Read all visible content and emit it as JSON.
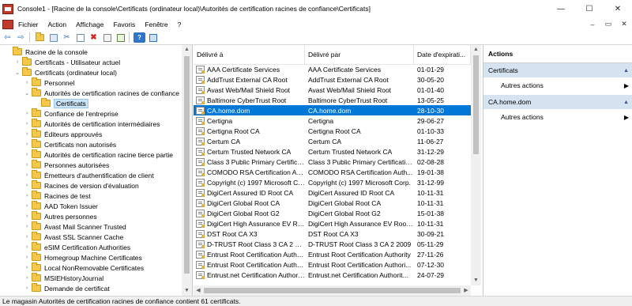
{
  "window": {
    "title": "Console1 - [Racine de la console\\Certificats (ordinateur local)\\Autorités de certification racines de confiance\\Certificats]",
    "minimize": "—",
    "maximize": "☐",
    "close": "✕"
  },
  "menu": {
    "items": [
      "Fichier",
      "Action",
      "Affichage",
      "Favoris",
      "Fenêtre",
      "?"
    ],
    "mdi_minimize": "–",
    "mdi_restore": "▭",
    "mdi_close": "✕"
  },
  "toolbar": {
    "buttons": [
      "back-icon",
      "forward-icon",
      "up-folder-icon",
      "properties-icon",
      "cut-icon",
      "copy-icon",
      "delete-icon",
      "properties-sheet-icon",
      "export-icon",
      "help-icon",
      "show-hide-icon"
    ],
    "back": "⇦",
    "forward": "⇨",
    "cut": "✂",
    "delete": "✖",
    "help": "?"
  },
  "tree": {
    "items": [
      {
        "label": "Racine de la console",
        "level": 0,
        "chevron": "",
        "selected": false
      },
      {
        "label": "Certificats - Utilisateur actuel",
        "level": 1,
        "chevron": "›",
        "selected": false
      },
      {
        "label": "Certificats (ordinateur local)",
        "level": 1,
        "chevron": "⌄",
        "selected": false
      },
      {
        "label": "Personnel",
        "level": 2,
        "chevron": "›",
        "selected": false
      },
      {
        "label": "Autorités de certification racines de confiance",
        "level": 2,
        "chevron": "⌄",
        "selected": false
      },
      {
        "label": "Certificats",
        "level": 3,
        "chevron": "",
        "selected": true
      },
      {
        "label": "Confiance de l'entreprise",
        "level": 2,
        "chevron": "›",
        "selected": false
      },
      {
        "label": "Autorités de certification intermédiaires",
        "level": 2,
        "chevron": "›",
        "selected": false
      },
      {
        "label": "Éditeurs approuvés",
        "level": 2,
        "chevron": "›",
        "selected": false
      },
      {
        "label": "Certificats non autorisés",
        "level": 2,
        "chevron": "›",
        "selected": false
      },
      {
        "label": "Autorités de certification racine tierce partie",
        "level": 2,
        "chevron": "›",
        "selected": false
      },
      {
        "label": "Personnes autorisées",
        "level": 2,
        "chevron": "›",
        "selected": false
      },
      {
        "label": "Émetteurs d'authentification de client",
        "level": 2,
        "chevron": "›",
        "selected": false
      },
      {
        "label": "Racines de version d'évaluation",
        "level": 2,
        "chevron": "›",
        "selected": false
      },
      {
        "label": "Racines de test",
        "level": 2,
        "chevron": "›",
        "selected": false
      },
      {
        "label": "AAD Token Issuer",
        "level": 2,
        "chevron": "›",
        "selected": false
      },
      {
        "label": "Autres personnes",
        "level": 2,
        "chevron": "›",
        "selected": false
      },
      {
        "label": "Avast Mail Scanner Trusted",
        "level": 2,
        "chevron": "›",
        "selected": false
      },
      {
        "label": "Avast SSL Scanner Cache",
        "level": 2,
        "chevron": "›",
        "selected": false
      },
      {
        "label": "eSIM Certification Authorities",
        "level": 2,
        "chevron": "›",
        "selected": false
      },
      {
        "label": "Homegroup Machine Certificates",
        "level": 2,
        "chevron": "›",
        "selected": false
      },
      {
        "label": "Local NonRemovable Certificates",
        "level": 2,
        "chevron": "›",
        "selected": false
      },
      {
        "label": "MSIEHistoryJournal",
        "level": 2,
        "chevron": "›",
        "selected": false
      },
      {
        "label": "Demande de certificat",
        "level": 2,
        "chevron": "›",
        "selected": false
      }
    ],
    "scroll_up": "▲",
    "scroll_down": "▼"
  },
  "list": {
    "headers": [
      "Délivré à",
      "Délivré par",
      "Date d'expirati..."
    ],
    "rows": [
      {
        "issued_to": "AAA Certificate Services",
        "issued_by": "AAA Certificate Services",
        "expires": "01-01-29",
        "selected": false
      },
      {
        "issued_to": "AddTrust External CA Root",
        "issued_by": "AddTrust External CA Root",
        "expires": "30-05-20",
        "selected": false
      },
      {
        "issued_to": "Avast Web/Mail Shield Root",
        "issued_by": "Avast Web/Mail Shield Root",
        "expires": "01-01-40",
        "selected": false
      },
      {
        "issued_to": "Baltimore CyberTrust Root",
        "issued_by": "Baltimore CyberTrust Root",
        "expires": "13-05-25",
        "selected": false
      },
      {
        "issued_to": "CA.home.dom",
        "issued_by": "CA.home.dom",
        "expires": "28-10-30",
        "selected": true
      },
      {
        "issued_to": "Certigna",
        "issued_by": "Certigna",
        "expires": "29-06-27",
        "selected": false
      },
      {
        "issued_to": "Certigna Root CA",
        "issued_by": "Certigna Root CA",
        "expires": "01-10-33",
        "selected": false
      },
      {
        "issued_to": "Certum CA",
        "issued_by": "Certum CA",
        "expires": "11-06-27",
        "selected": false
      },
      {
        "issued_to": "Certum Trusted Network CA",
        "issued_by": "Certum Trusted Network CA",
        "expires": "31-12-29",
        "selected": false
      },
      {
        "issued_to": "Class 3 Public Primary Certification...",
        "issued_by": "Class 3 Public Primary Certificatio...",
        "expires": "02-08-28",
        "selected": false
      },
      {
        "issued_to": "COMODO RSA Certification Autho...",
        "issued_by": "COMODO RSA Certification Auth...",
        "expires": "19-01-38",
        "selected": false
      },
      {
        "issued_to": "Copyright (c) 1997 Microsoft Corp.",
        "issued_by": "Copyright (c) 1997 Microsoft Corp.",
        "expires": "31-12-99",
        "selected": false
      },
      {
        "issued_to": "DigiCert Assured ID Root CA",
        "issued_by": "DigiCert Assured ID Root CA",
        "expires": "10-11-31",
        "selected": false
      },
      {
        "issued_to": "DigiCert Global Root CA",
        "issued_by": "DigiCert Global Root CA",
        "expires": "10-11-31",
        "selected": false
      },
      {
        "issued_to": "DigiCert Global Root G2",
        "issued_by": "DigiCert Global Root G2",
        "expires": "15-01-38",
        "selected": false
      },
      {
        "issued_to": "DigiCert High Assurance EV Root ...",
        "issued_by": "DigiCert High Assurance EV Root ...",
        "expires": "10-11-31",
        "selected": false
      },
      {
        "issued_to": "DST Root CA X3",
        "issued_by": "DST Root CA X3",
        "expires": "30-09-21",
        "selected": false
      },
      {
        "issued_to": "D-TRUST Root Class 3 CA 2 2009",
        "issued_by": "D-TRUST Root Class 3 CA 2 2009",
        "expires": "05-11-29",
        "selected": false
      },
      {
        "issued_to": "Entrust Root Certification Authority",
        "issued_by": "Entrust Root Certification Authority",
        "expires": "27-11-26",
        "selected": false
      },
      {
        "issued_to": "Entrust Root Certification Authori...",
        "issued_by": "Entrust Root Certification Authori...",
        "expires": "07-12-30",
        "selected": false
      },
      {
        "issued_to": "Entrust.net Certification Authorit...",
        "issued_by": "Entrust.net Certification Authorit...",
        "expires": "24-07-29",
        "selected": false
      }
    ],
    "scroll_up": "▲",
    "scroll_down": "▼",
    "scroll_left": "◀",
    "scroll_right": "▶"
  },
  "actions": {
    "title": "Actions",
    "sections": [
      {
        "header": "Certificats",
        "item": "Autres actions"
      },
      {
        "header": "CA.home.dom",
        "item": "Autres actions"
      }
    ],
    "collapse_glyph": "▲",
    "more_glyph": "▶"
  },
  "status": {
    "text": "Le magasin Autorités de certification racines de confiance contient 61 certificats."
  },
  "colors": {
    "selection_blue": "#0078d7",
    "tree_selection": "#cce4f7",
    "section_header": "#d6e4f2"
  }
}
